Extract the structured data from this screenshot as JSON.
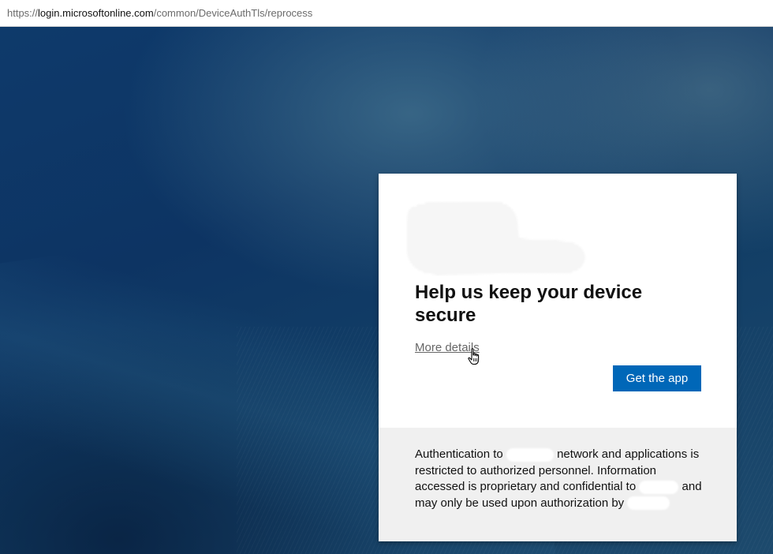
{
  "browser": {
    "url_scheme": "https://",
    "url_host": "login.microsoftonline.com",
    "url_path": "/common/DeviceAuthTls/reprocess"
  },
  "card": {
    "title": "Help us keep your device secure",
    "more_details_label": "More details",
    "get_app_label": "Get the app",
    "footer": {
      "part1": "Authentication to",
      "part2": "network and applications is restricted to authorized personnel. Information accessed is proprietary and confidential to",
      "part3": "and may only be used upon authorization by"
    }
  },
  "colors": {
    "button": "#0067b8",
    "footer_bg": "#f0f0f0",
    "background": "#0e3a6b"
  },
  "icons": {
    "cursor": "hand-pointer-icon"
  }
}
